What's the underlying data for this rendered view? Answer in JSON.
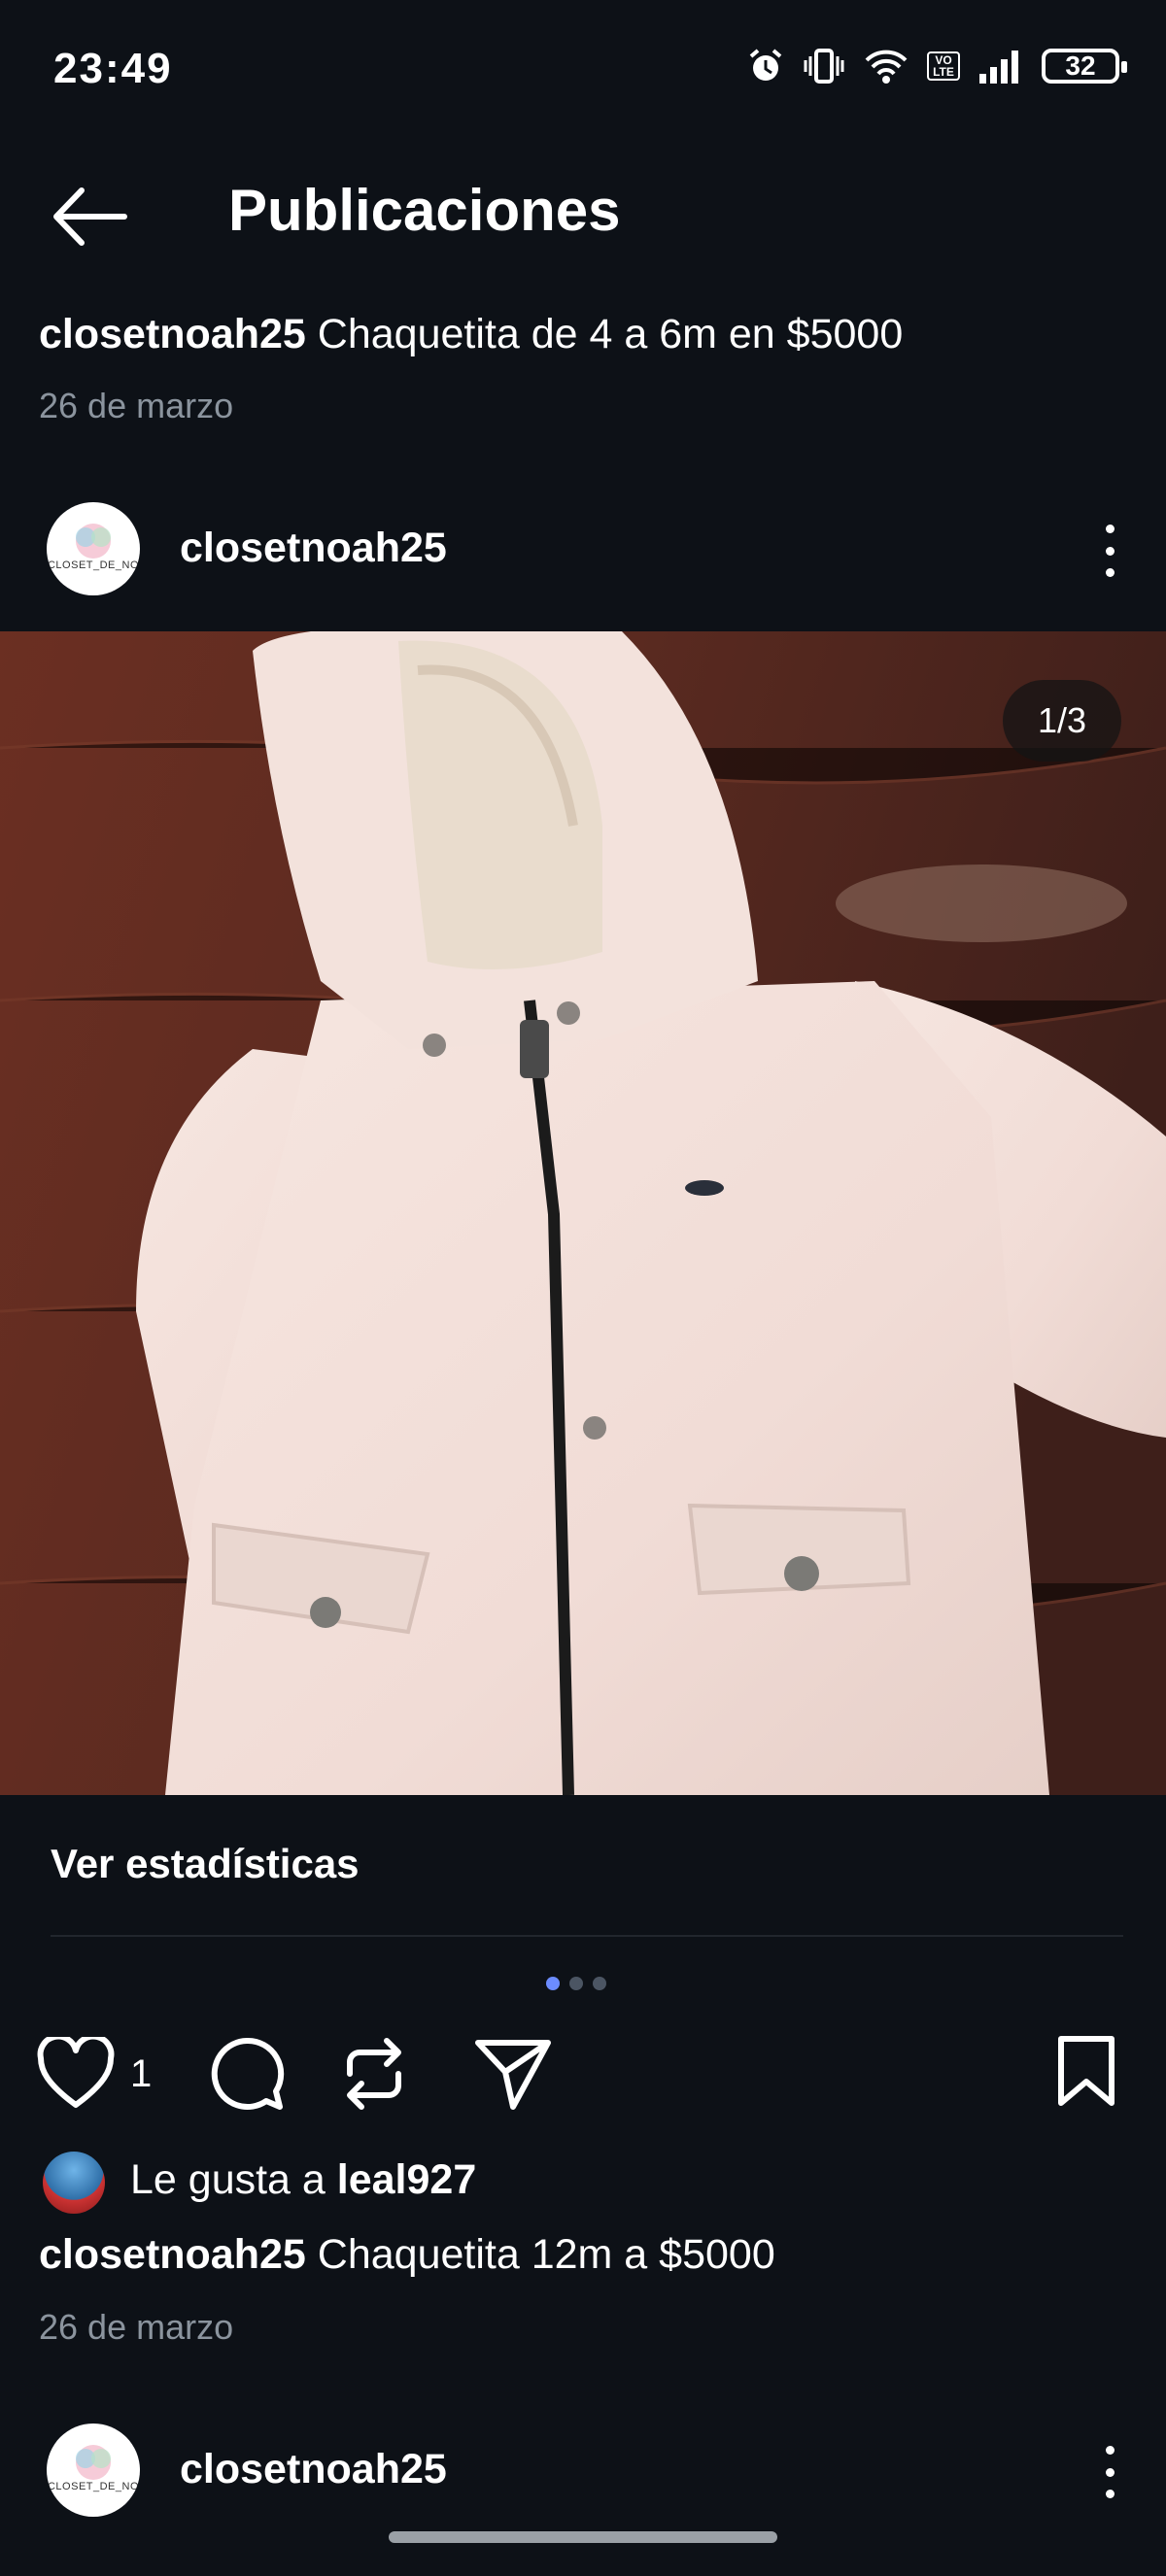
{
  "status_bar": {
    "time": "23:49",
    "battery": "32",
    "network_badge": "VO LTE"
  },
  "header": {
    "title": "Publicaciones",
    "back_icon": "arrow-left-icon"
  },
  "post1": {
    "username": "closetnoah25",
    "caption": "Chaquetita de 4 a 6m en $5000",
    "date": "26 de marzo"
  },
  "post2": {
    "username": "closetnoah25",
    "avatar_text": "CLOSET_DE_NO",
    "image_counter": "1/3",
    "stats_link": "Ver estadísticas",
    "carousel": {
      "count": 3,
      "active": 0
    },
    "likes": "1",
    "liked_by_prefix": "Le gusta a",
    "liked_by_user": "leal927",
    "caption_user": "closetnoah25",
    "caption": "Chaquetita 12m a $5000",
    "date": "26 de marzo"
  },
  "post3": {
    "username": "closetnoah25",
    "avatar_text": "CLOSET_DE_NO"
  },
  "colors": {
    "background": "#0d1117",
    "accent": "#6c8cff",
    "muted": "#8b949e"
  }
}
